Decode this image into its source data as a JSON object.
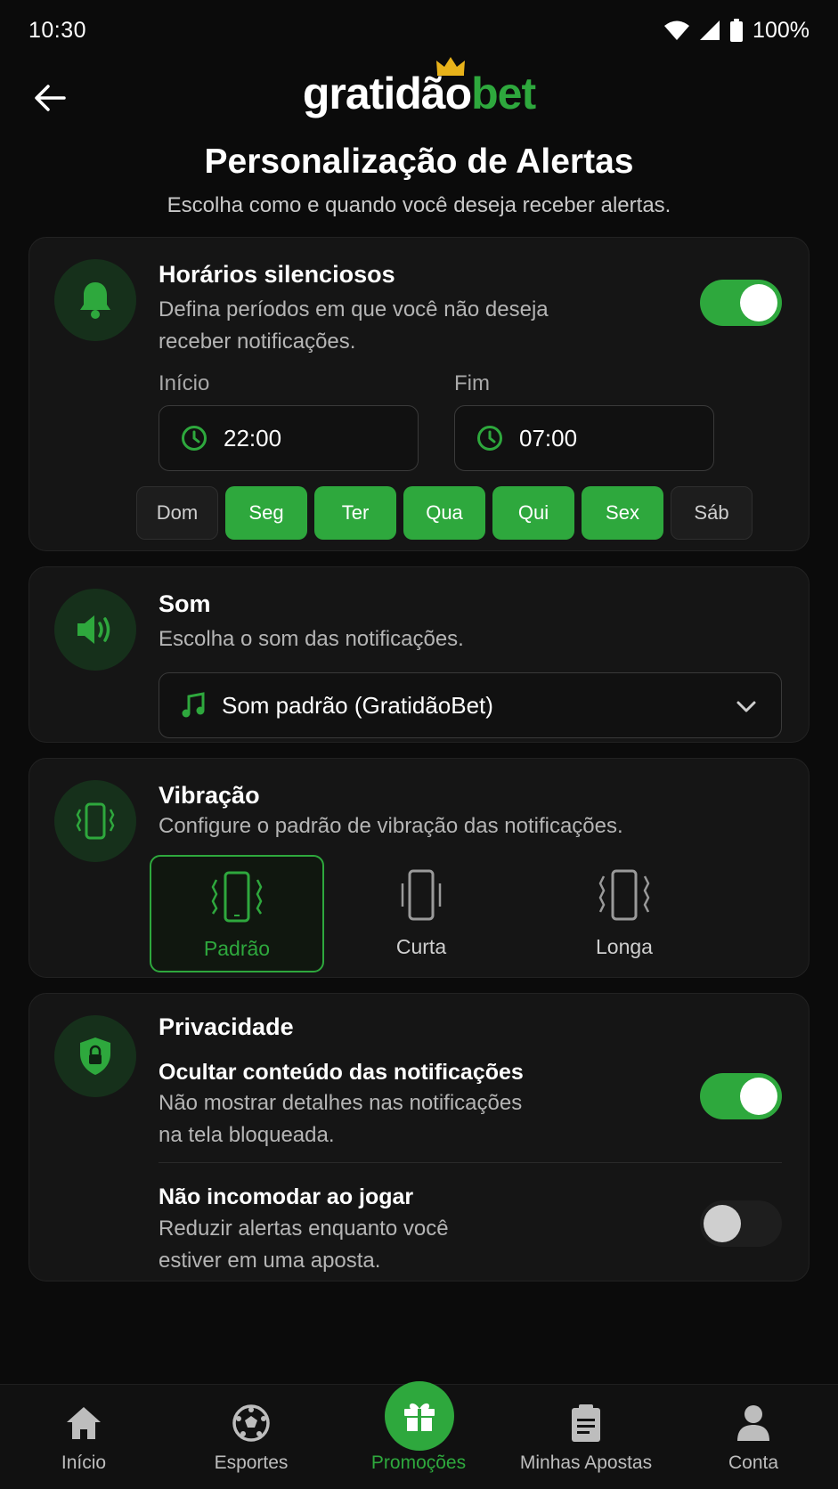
{
  "status_bar": {
    "time": "10:30",
    "battery": "100%"
  },
  "header": {
    "logo_part1": "gratidão",
    "logo_part2": "bet"
  },
  "page": {
    "title": "Personalização de Alertas",
    "subtitle": "Escolha como e quando você deseja receber alertas."
  },
  "quiet_hours": {
    "title": "Horários silenciosos",
    "desc_line1": "Defina períodos em que você não deseja",
    "desc_line2": "receber notificações.",
    "enabled": true,
    "start_label": "Início",
    "start_value": "22:00",
    "end_label": "Fim",
    "end_value": "07:00",
    "days": [
      {
        "label": "Dom",
        "active": false
      },
      {
        "label": "Seg",
        "active": true
      },
      {
        "label": "Ter",
        "active": true
      },
      {
        "label": "Qua",
        "active": true
      },
      {
        "label": "Qui",
        "active": true
      },
      {
        "label": "Sex",
        "active": true
      },
      {
        "label": "Sáb",
        "active": false
      }
    ]
  },
  "sound": {
    "title": "Som",
    "desc": "Escolha o som das notificações.",
    "selected": "Som padrão (GratidãoBet)"
  },
  "vibration": {
    "title": "Vibração",
    "desc": "Configure o padrão de vibração das notificações.",
    "options": [
      {
        "label": "Padrão",
        "selected": true
      },
      {
        "label": "Curta",
        "selected": false
      },
      {
        "label": "Longa",
        "selected": false
      }
    ]
  },
  "privacy": {
    "title": "Privacidade",
    "hide_content": {
      "title": "Ocultar conteúdo das notificações",
      "desc_line1": "Não mostrar detalhes nas notificações",
      "desc_line2": "na tela bloqueada.",
      "enabled": true
    },
    "dnd_gaming": {
      "title": "Não incomodar ao jogar",
      "desc_line1": "Reduzir alertas enquanto você",
      "desc_line2": "estiver em uma aposta.",
      "enabled": false
    }
  },
  "bottom_nav": [
    {
      "label": "Início",
      "icon": "home-icon",
      "active": false
    },
    {
      "label": "Esportes",
      "icon": "soccer-ball-icon",
      "active": false
    },
    {
      "label": "Promoções",
      "icon": "gift-icon",
      "active": true
    },
    {
      "label": "Minhas Apostas",
      "icon": "clipboard-icon",
      "active": false
    },
    {
      "label": "Conta",
      "icon": "user-icon",
      "active": false
    }
  ],
  "colors": {
    "accent": "#2ea83d",
    "background": "#0b0b0b",
    "card": "#151515",
    "crown": "#e8b21a"
  }
}
